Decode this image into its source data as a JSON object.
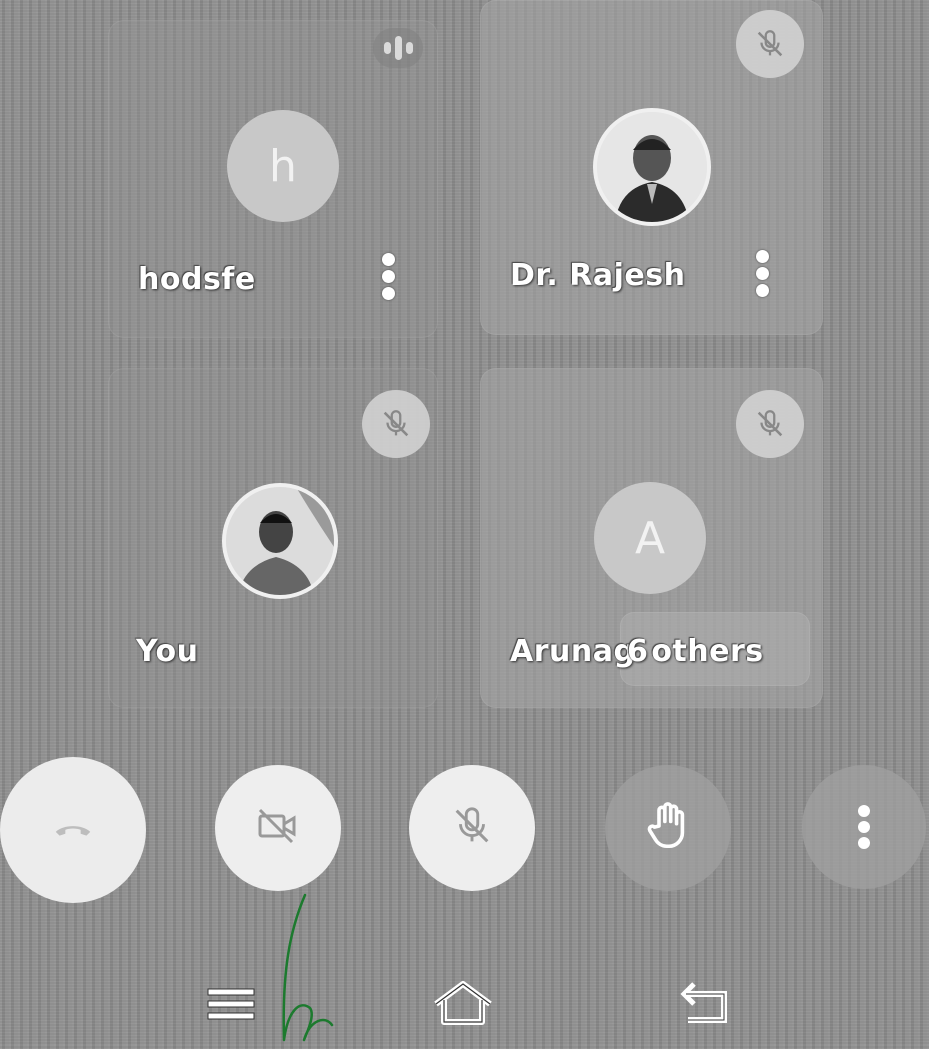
{
  "top_indicator": {
    "icon": "speaker-activity-icon"
  },
  "participants": [
    {
      "name": "hodsfe",
      "avatar_letter": "h",
      "avatar_type": "letter",
      "muted": false
    },
    {
      "name": "Dr. Rajesh",
      "avatar_type": "photo",
      "muted": true
    },
    {
      "name": "You",
      "avatar_type": "photo",
      "muted": true
    },
    {
      "name": "Arunag",
      "avatar_letter": "A",
      "avatar_type": "letter",
      "muted": true,
      "others_label": "6 others"
    }
  ],
  "controls": [
    {
      "id": "end-call",
      "icon": "phone-hangup-icon"
    },
    {
      "id": "camera",
      "icon": "video-off-icon"
    },
    {
      "id": "mic",
      "icon": "mic-off-icon"
    },
    {
      "id": "raise-hand",
      "icon": "hand-icon"
    },
    {
      "id": "more",
      "icon": "more-vert-icon"
    }
  ],
  "system_nav": [
    {
      "id": "recents",
      "icon": "menu-icon"
    },
    {
      "id": "home",
      "icon": "home-icon"
    },
    {
      "id": "back",
      "icon": "back-icon"
    }
  ]
}
